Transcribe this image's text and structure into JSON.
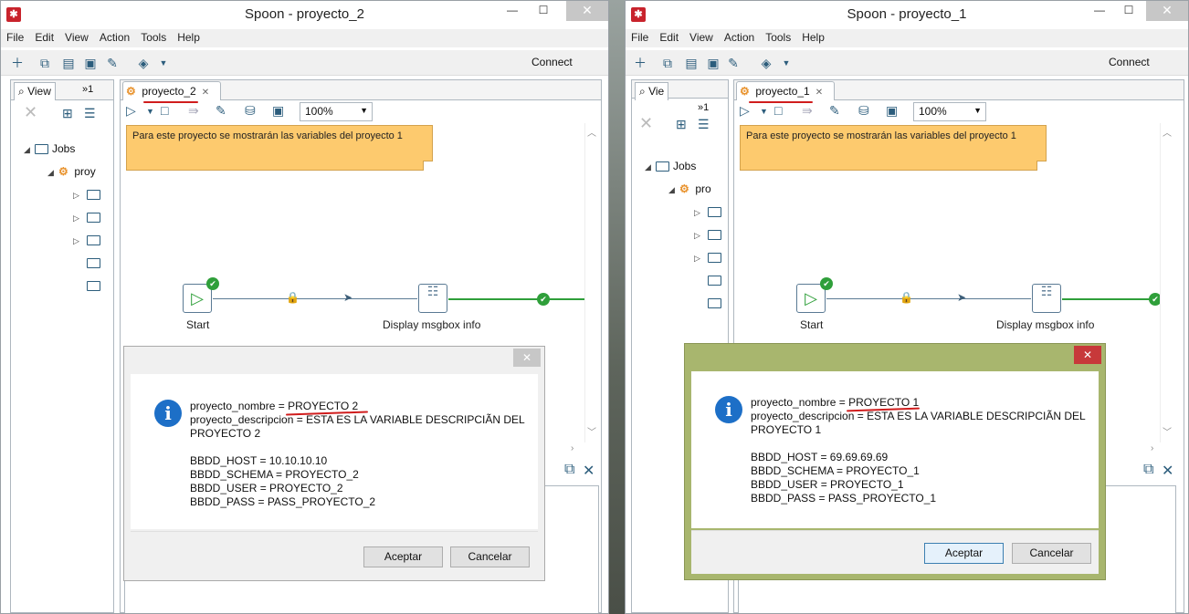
{
  "windows": [
    {
      "id": "w2",
      "title": "Spoon - proyecto_2",
      "menu": [
        "File",
        "Edit",
        "View",
        "Action",
        "Tools",
        "Help"
      ],
      "connect_label": "Connect",
      "left_tab": "View",
      "left_more": "»1",
      "tree_root": "Jobs",
      "tree_job": "proy",
      "editor_tab": "proyecto_2",
      "zoom": "100%",
      "note": "Para este proyecto se mostrarán las variables del proyecto 1",
      "entry_start": "Start",
      "entry_msg": "Display msgbox info",
      "dialog": {
        "lines": [
          "proyecto_nombre = PROYECTO 2",
          "proyecto_descripcion = ESTA ES LA VARIABLE DESCRIPCIÃN DEL",
          "PROYECTO 2",
          "",
          "BBDD_HOST = 10.10.10.10",
          "BBDD_SCHEMA = PROYECTO_2",
          "BBDD_USER = PROYECTO_2",
          "BBDD_PASS = PASS_PROYECTO_2"
        ],
        "ok": "Aceptar",
        "cancel": "Cancelar"
      }
    },
    {
      "id": "w1",
      "title": "Spoon - proyecto_1",
      "menu": [
        "File",
        "Edit",
        "View",
        "Action",
        "Tools",
        "Help"
      ],
      "connect_label": "Connect",
      "left_tab": "Vie",
      "left_more": "»1",
      "tree_root": "Jobs",
      "tree_job": "pro",
      "editor_tab": "proyecto_1",
      "zoom": "100%",
      "note": "Para este proyecto se mostrarán las variables del proyecto 1",
      "entry_start": "Start",
      "entry_msg": "Display msgbox info",
      "dialog": {
        "lines": [
          "proyecto_nombre = PROYECTO 1",
          "proyecto_descripcion = ESTA ES LA VARIABLE DESCRIPCIÃN DEL",
          "PROYECTO 1",
          "",
          "BBDD_HOST = 69.69.69.69",
          "BBDD_SCHEMA = PROYECTO_1",
          "BBDD_USER = PROYECTO_1",
          "BBDD_PASS = PASS_PROYECTO_1"
        ],
        "ok": "Aceptar",
        "cancel": "Cancelar"
      }
    }
  ],
  "colors": {
    "dialog_active": "#a8b66e",
    "dialog_inactive": "#f0f0f0",
    "close_active": "#c7393a",
    "note": "#fdca6e",
    "hop_ok": "#2f9f3a"
  }
}
